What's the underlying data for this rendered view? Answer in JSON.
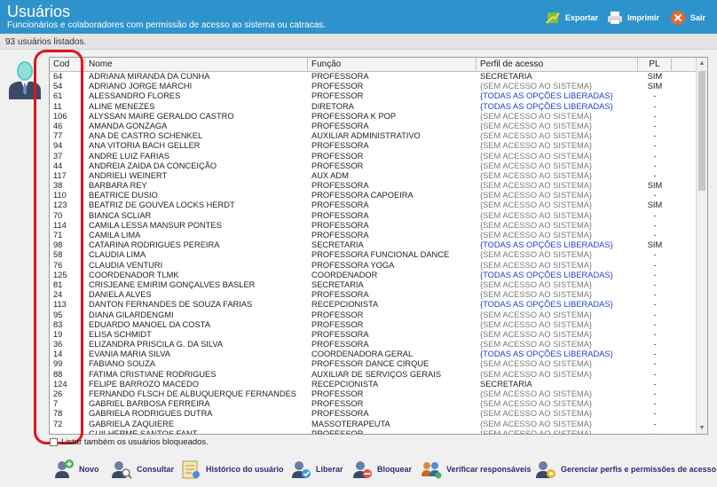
{
  "header": {
    "title": "Usuários",
    "subtitle": "Funcionários e colaboradores com permissão de acesso ao sistema ou catracas.",
    "export_label": "Exportar",
    "print_label": "Imprimir",
    "exit_label": "Sair"
  },
  "count_text": "93 usuários listados.",
  "table": {
    "columns": [
      "Cod",
      "Nome",
      "Função",
      "Perfil de acesso",
      "PL"
    ],
    "rows": [
      {
        "cod": "64",
        "nome": "ADRIANA MIRANDA DA CUNHA",
        "funcao": "PROFESSORA",
        "perfil": "SECRETARIA",
        "pl": "SIM"
      },
      {
        "cod": "54",
        "nome": "ADRIANO JORGE MARCHI",
        "funcao": "PROFESSOR",
        "perfil": "{SEM ACESSO AO SISTEMA}",
        "pl": "SIM"
      },
      {
        "cod": "61",
        "nome": "ALESSANDRO FLORES",
        "funcao": "PROFESSOR",
        "perfil": "{TODAS AS OPÇÕES LIBERADAS}",
        "pl": "-"
      },
      {
        "cod": "11",
        "nome": "ALINE MENEZES",
        "funcao": "DIRETORA",
        "perfil": "{TODAS AS OPÇÕES LIBERADAS}",
        "pl": "-"
      },
      {
        "cod": "106",
        "nome": "ALYSSAN MAIRE GERALDO CASTRO",
        "funcao": "PROFESSORA K POP",
        "perfil": "{SEM ACESSO AO SISTEMA}",
        "pl": "-"
      },
      {
        "cod": "46",
        "nome": "AMANDA GONZAGA",
        "funcao": "PROFESSORA",
        "perfil": "{SEM ACESSO AO SISTEMA}",
        "pl": "-"
      },
      {
        "cod": "77",
        "nome": "ANA DE CASTRO SCHENKEL",
        "funcao": "AUXILIAR ADMINISTRATIVO",
        "perfil": "{SEM ACESSO AO SISTEMA}",
        "pl": "-"
      },
      {
        "cod": "94",
        "nome": "ANA VITORIA BACH GELLER",
        "funcao": "PROFESSORA",
        "perfil": "{SEM ACESSO AO SISTEMA}",
        "pl": "-"
      },
      {
        "cod": "37",
        "nome": "ANDRE LUIZ FARIAS",
        "funcao": "PROFESSOR",
        "perfil": "{SEM ACESSO AO SISTEMA}",
        "pl": "-"
      },
      {
        "cod": "44",
        "nome": "ANDREIA ZAIDA DA CONCEIÇÃO",
        "funcao": "PROFESSOR",
        "perfil": "{SEM ACESSO AO SISTEMA}",
        "pl": "-"
      },
      {
        "cod": "117",
        "nome": "ANDRIELI WEINERT",
        "funcao": "AUX ADM",
        "perfil": "{SEM ACESSO AO SISTEMA}",
        "pl": "-"
      },
      {
        "cod": "38",
        "nome": "BARBARA REY",
        "funcao": "PROFESSORA",
        "perfil": "{SEM ACESSO AO SISTEMA}",
        "pl": "SIM"
      },
      {
        "cod": "110",
        "nome": "BEATRICE DUSIO",
        "funcao": "PROFESSORA CAPOEIRA",
        "perfil": "{SEM ACESSO AO SISTEMA}",
        "pl": "-"
      },
      {
        "cod": "123",
        "nome": "BEATRIZ DE GOUVEA LOCKS HERDT",
        "funcao": "PROFESSORA",
        "perfil": "{SEM ACESSO AO SISTEMA}",
        "pl": "SIM"
      },
      {
        "cod": "70",
        "nome": "BIANCA SCLIAR",
        "funcao": "PROFESSORA",
        "perfil": "{SEM ACESSO AO SISTEMA}",
        "pl": "-"
      },
      {
        "cod": "114",
        "nome": "CAMILA LESSA MANSUR PONTES",
        "funcao": "PROFESSORA",
        "perfil": "{SEM ACESSO AO SISTEMA}",
        "pl": "-"
      },
      {
        "cod": "71",
        "nome": "CAMILA LIMA",
        "funcao": "PROFESSORA",
        "perfil": "{SEM ACESSO AO SISTEMA}",
        "pl": "-"
      },
      {
        "cod": "98",
        "nome": "CATARINA RODRIGUES PEREIRA",
        "funcao": "SECRETARIA",
        "perfil": "{TODAS AS OPÇÕES LIBERADAS}",
        "pl": "SIM"
      },
      {
        "cod": "58",
        "nome": "CLAUDIA LIMA",
        "funcao": "PROFESSORA FUNCIONAL DANCE",
        "perfil": "{SEM ACESSO AO SISTEMA}",
        "pl": "-"
      },
      {
        "cod": "76",
        "nome": "CLAUDIA VENTURI",
        "funcao": "PROFESSORA YOGA",
        "perfil": "{SEM ACESSO AO SISTEMA}",
        "pl": "-"
      },
      {
        "cod": "125",
        "nome": "COORDENADOR TLMK",
        "funcao": "COORDENADOR",
        "perfil": "{TODAS AS OPÇÕES LIBERADAS}",
        "pl": "-"
      },
      {
        "cod": "81",
        "nome": "CRISJEANE EMIRIM GONÇALVES BASLER",
        "funcao": "SECRETARIA",
        "perfil": "{SEM ACESSO AO SISTEMA}",
        "pl": "-"
      },
      {
        "cod": "24",
        "nome": "DANIELA ALVES",
        "funcao": "PROFESSORA",
        "perfil": "{SEM ACESSO AO SISTEMA}",
        "pl": "-"
      },
      {
        "cod": "113",
        "nome": "DANTON FERNANDES DE SOUZA FARIAS",
        "funcao": "RECEPCIONISTA",
        "perfil": "{TODAS AS OPÇÕES LIBERADAS}",
        "pl": "-"
      },
      {
        "cod": "95",
        "nome": "DIANA GILARDENGMI",
        "funcao": "PROFESSOR",
        "perfil": "{SEM ACESSO AO SISTEMA}",
        "pl": "-"
      },
      {
        "cod": "83",
        "nome": "EDUARDO MANOEL DA COSTA",
        "funcao": "PROFESSOR",
        "perfil": "{SEM ACESSO AO SISTEMA}",
        "pl": "-"
      },
      {
        "cod": "19",
        "nome": "ELISA SCHMIDT",
        "funcao": "PROFESSORA",
        "perfil": "{SEM ACESSO AO SISTEMA}",
        "pl": "-"
      },
      {
        "cod": "36",
        "nome": "ELIZANDRA PRISCILA G. DA SILVA",
        "funcao": "PROFESSORA",
        "perfil": "{SEM ACESSO AO SISTEMA}",
        "pl": "-"
      },
      {
        "cod": "14",
        "nome": "EVANIA MARIA SILVA",
        "funcao": "COORDENADORA GERAL",
        "perfil": "{TODAS AS OPÇÕES LIBERADAS}",
        "pl": "-"
      },
      {
        "cod": "99",
        "nome": "FABIANO SOUZA",
        "funcao": "PROFESSOR DANCE CIRQUE",
        "perfil": "{SEM ACESSO AO SISTEMA}",
        "pl": "-"
      },
      {
        "cod": "88",
        "nome": "FATIMA CRISTIANE RODRIGUES",
        "funcao": "AUXILIAR DE SERVIÇOS GERAIS",
        "perfil": "{SEM ACESSO AO SISTEMA}",
        "pl": "-"
      },
      {
        "cod": "124",
        "nome": "FELIPE BARROZO MACEDO",
        "funcao": "RECEPCIONISTA",
        "perfil": "SECRETARIA",
        "pl": "-"
      },
      {
        "cod": "26",
        "nome": "FERNANDO FLSCH DE ALBUQUERQUE FERNANDES",
        "funcao": "PROFESSOR",
        "perfil": "{SEM ACESSO AO SISTEMA}",
        "pl": "-"
      },
      {
        "cod": "7",
        "nome": "GABRIEL BARBOSA FERREIRA",
        "funcao": "PROFESSOR",
        "perfil": "{SEM ACESSO AO SISTEMA}",
        "pl": "-"
      },
      {
        "cod": "78",
        "nome": "GABRIELA RODRIGUES DUTRA",
        "funcao": "PROFESSORA",
        "perfil": "{SEM ACESSO AO SISTEMA}",
        "pl": "-"
      },
      {
        "cod": "72",
        "nome": "GABRIELA ZAQUIERE",
        "funcao": "MASSOTERAPEUTA",
        "perfil": "{SEM ACESSO AO SISTEMA}",
        "pl": "-"
      },
      {
        "cod": "",
        "nome": "GUILHERME SANTOS FANT",
        "funcao": "PROFESSOR",
        "perfil": "{SEM ACESSO AO SISTEMA}",
        "pl": "-"
      }
    ]
  },
  "checkbox_label": "Listar também os usuários bloqueados.",
  "footer": {
    "novo": "Novo",
    "consultar": "Consultar",
    "historico": "Histórico do usuário",
    "liberar": "Liberar",
    "bloquear": "Bloquear",
    "verificar": "Verificar responsáveis",
    "gerenciar": "Gerenciar perfis e permissões de acesso"
  },
  "colors": {
    "header_bg": "#2e93cc",
    "highlight": "#e01418",
    "perfil_all": "#1e3fd4",
    "perfil_none": "#7a7a7a"
  }
}
